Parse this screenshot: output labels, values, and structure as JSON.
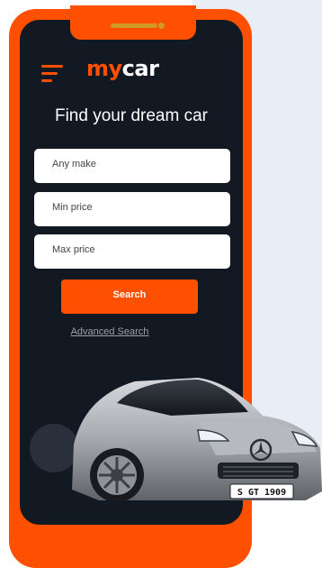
{
  "app": {
    "brand_prefix": "my",
    "brand_suffix": "car"
  },
  "hero": {
    "title": "Find your dream car"
  },
  "search": {
    "make_placeholder": "Any make",
    "min_price_placeholder": "Min price",
    "max_price_placeholder": "Max price",
    "submit_label": "Search",
    "advanced_link": "Advanced Search"
  },
  "car": {
    "license_plate": "S GT 1909"
  },
  "colors": {
    "accent": "#ff4f00",
    "screen_bg": "#131922",
    "backdrop": "#e9edf5"
  },
  "icons": {
    "menu": "hamburger-menu-icon"
  }
}
